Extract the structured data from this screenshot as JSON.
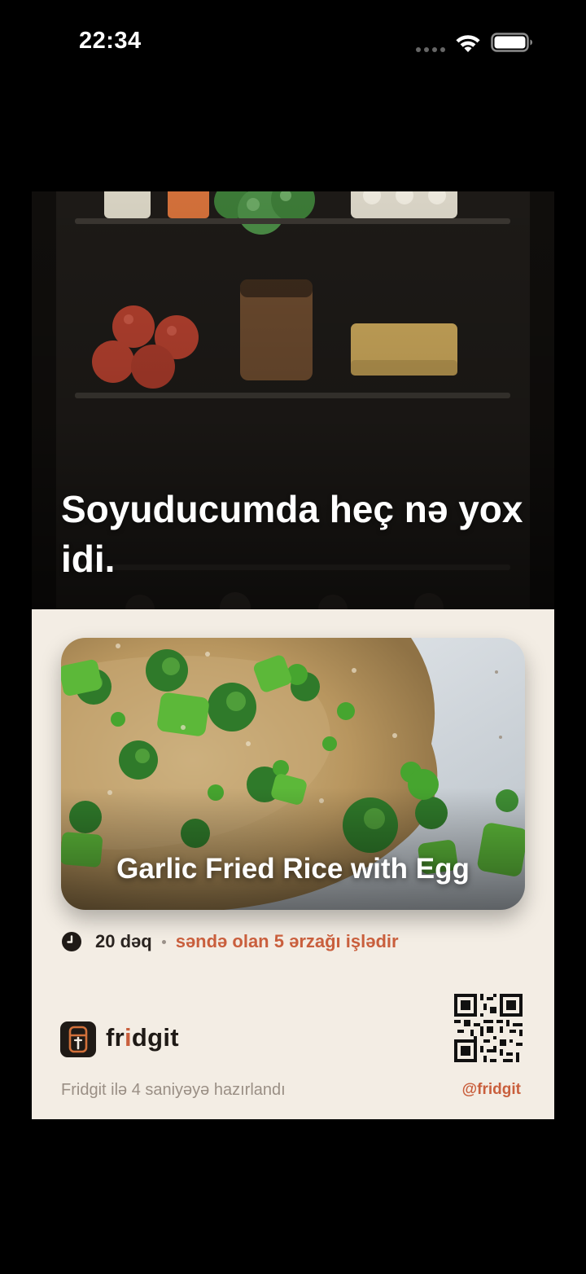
{
  "status_bar": {
    "time": "22:34"
  },
  "card": {
    "headline": "Soyuducumda heç nə yox idi.",
    "recipe": {
      "title": "Garlic Fried Rice with Egg",
      "time": "20 dəq",
      "ingredients_note": "səndə olan 5 ərzağı işlədir"
    },
    "brand": {
      "name_prefix": "fr",
      "name_accent": "i",
      "name_suffix": "dgit",
      "made_with": "Fridgit ilə 4 saniyəyə hazırlandı",
      "handle": "@fridgit"
    },
    "colors": {
      "accent": "#c95f3d",
      "card_bg": "#f3ede4",
      "fridge_bg": "#141210"
    },
    "icons": [
      "clock-icon",
      "fridgit-logo-icon",
      "qr-code-icon",
      "wifi-icon",
      "battery-icon"
    ]
  }
}
